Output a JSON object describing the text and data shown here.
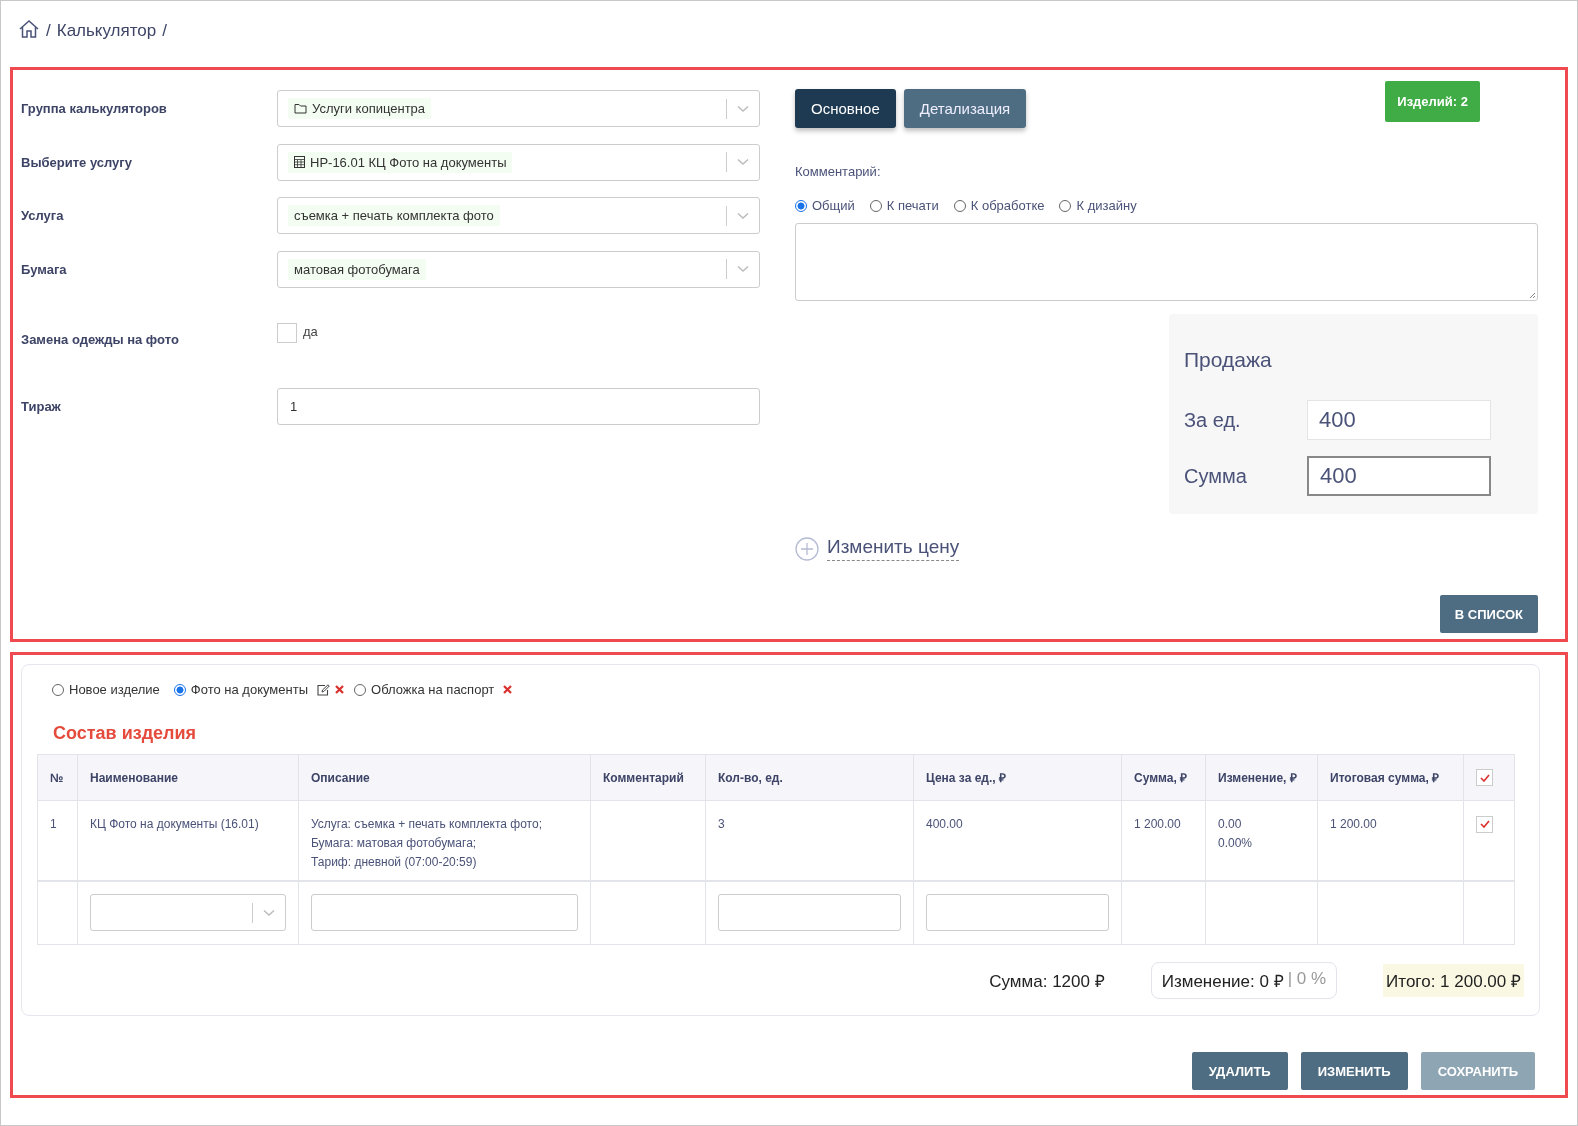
{
  "breadcrumb": [
    {
      "kind": "home"
    },
    {
      "kind": "sep",
      "text": "/"
    },
    {
      "kind": "link",
      "text": "Калькулятор"
    },
    {
      "kind": "sep",
      "text": "/"
    }
  ],
  "form": {
    "fields": [
      {
        "kind": "folder_select",
        "label": "Группа калькуляторов",
        "value": "Услуги копицентра"
      },
      {
        "kind": "calculator_select",
        "label": "Выберите услугу",
        "value": "НР-16.01 КЦ Фото на документы"
      },
      {
        "kind": "select",
        "label": "Услуга",
        "value": "съемка + печать комплекта фото"
      },
      {
        "kind": "select",
        "label": "Бумага",
        "value": "матовая фотобумага"
      },
      {
        "kind": "checkbox",
        "label": "Замена одежды на фото",
        "option": "да",
        "checked": false
      },
      {
        "kind": "input",
        "label": "Тираж",
        "value": "1"
      }
    ]
  },
  "tabs": [
    {
      "label": "Основное",
      "selected": true
    },
    {
      "label": "Детализация",
      "selected": false
    }
  ],
  "items_badge": "Изделий: 2",
  "comment": {
    "label": "Комментарий:",
    "types": [
      {
        "label": "Общий",
        "selected": true
      },
      {
        "label": "К печати",
        "selected": false
      },
      {
        "label": "К обработке",
        "selected": false
      },
      {
        "label": "К дизайну",
        "selected": false
      }
    ]
  },
  "sale": {
    "title": "Продажа",
    "rows": [
      {
        "label": "За ед.",
        "value": "400",
        "focused": false
      },
      {
        "label": "Сумма",
        "value": "400",
        "focused": true
      }
    ]
  },
  "change_price": "Изменить цену",
  "to_list_button": "В СПИСОК",
  "products": [
    {
      "label": "Новое изделие",
      "selected": false,
      "editable": false,
      "deletable": false
    },
    {
      "label": "Фото на документы",
      "selected": true,
      "editable": true,
      "deletable": true
    },
    {
      "label": "Обложка на паспорт",
      "selected": false,
      "editable": false,
      "deletable": true
    }
  ],
  "section_title": "Состав изделия",
  "table": {
    "columns": [
      "№",
      "Наименование",
      "Описание",
      "Комментарий",
      "Кол-во, ед.",
      "Цена за ед., ₽",
      "Сумма, ₽",
      "Изменение, ₽",
      "Итоговая сумма, ₽"
    ],
    "header_checked": true,
    "rows": [
      {
        "cells": [
          [
            "1"
          ],
          [
            "КЦ Фото на документы (16.01)"
          ],
          [
            "Услуга: съемка + печать комплекта фото;",
            "Бумага: матовая фотобумага;",
            "Тариф: дневной (07:00-20:59)"
          ],
          [],
          [
            "3"
          ],
          [
            "400.00"
          ],
          [
            "1 200.00"
          ],
          [
            "0.00",
            "0.00%"
          ],
          [
            "1 200.00"
          ]
        ],
        "checked": true
      }
    ]
  },
  "totals": {
    "sum": "Сумма: 1200 ₽",
    "change": "Изменение: 0 ₽",
    "change_percent": "| 0 %",
    "total": "Итого: 1 200.00 ₽"
  },
  "buttons": [
    {
      "label": "УДАЛИТЬ",
      "disabled": false
    },
    {
      "label": "ИЗМЕНИТЬ",
      "disabled": false
    },
    {
      "label": "СОХРАНИТЬ",
      "disabled": true
    }
  ]
}
